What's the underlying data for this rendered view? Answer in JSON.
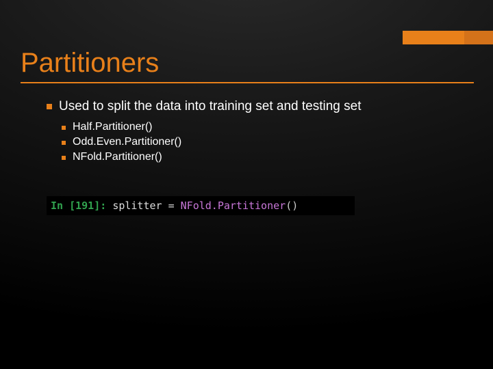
{
  "slide": {
    "title": "Partitioners",
    "bullets_lvl1": [
      "Used to split the data into training set and testing set"
    ],
    "bullets_lvl2": [
      "Half.Partitioner()",
      "Odd.Even.Partitioner()",
      "NFold.Partitioner()"
    ]
  },
  "code": {
    "prompt": "In [191]:",
    "var": "splitter",
    "eq": "=",
    "func": "NFold.Partitioner",
    "paren": "()"
  }
}
